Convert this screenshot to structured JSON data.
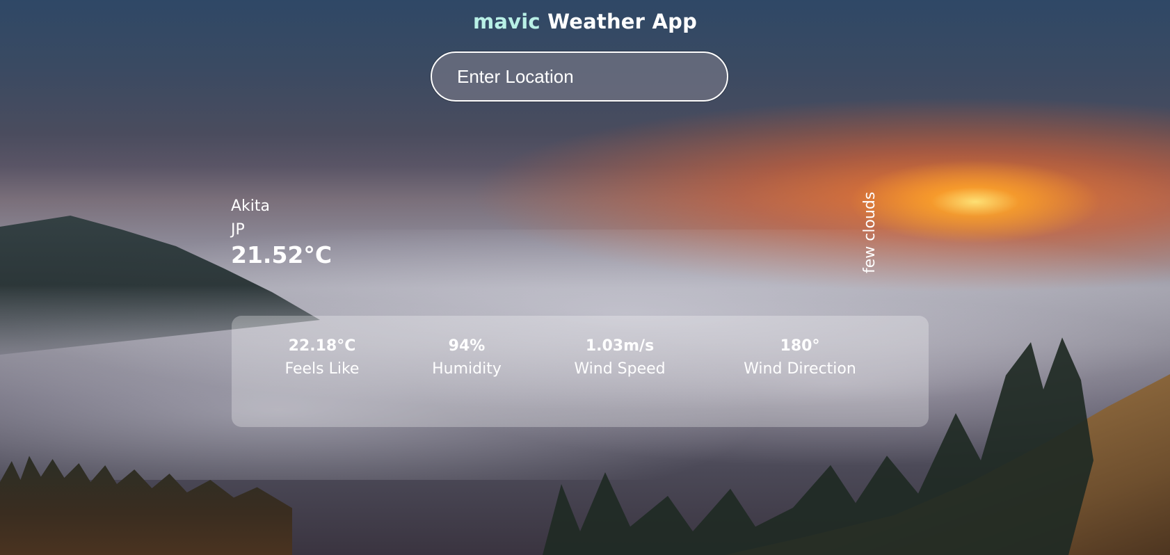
{
  "header": {
    "brand": "mavic",
    "title": "Weather App",
    "brand_color": "#b9f0e6"
  },
  "search": {
    "placeholder": "Enter Location"
  },
  "current": {
    "city": "Akita",
    "country": "JP",
    "temperature": "21.52°C",
    "description": "few clouds"
  },
  "details": [
    {
      "value": "22.18°C",
      "label": "Feels Like"
    },
    {
      "value": "94%",
      "label": "Humidity"
    },
    {
      "value": "1.03m/s",
      "label": "Wind Speed"
    },
    {
      "value": "180°",
      "label": "Wind Direction"
    }
  ]
}
